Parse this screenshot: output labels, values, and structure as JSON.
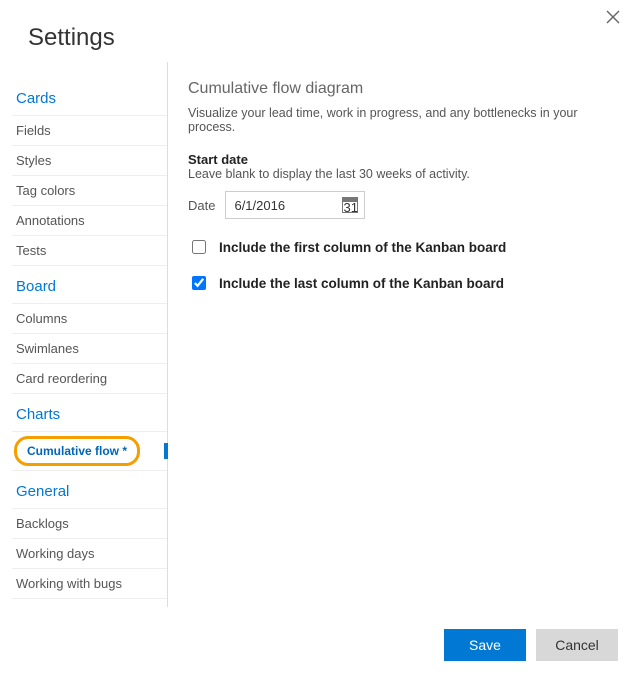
{
  "title": "Settings",
  "sidebar": {
    "sections": [
      {
        "head": "Cards",
        "items": [
          "Fields",
          "Styles",
          "Tag colors",
          "Annotations",
          "Tests"
        ]
      },
      {
        "head": "Board",
        "items": [
          "Columns",
          "Swimlanes",
          "Card reordering"
        ]
      },
      {
        "head": "Charts",
        "items": [
          "Cumulative flow *"
        ],
        "selectedIndex": 0
      },
      {
        "head": "General",
        "items": [
          "Backlogs",
          "Working days",
          "Working with bugs"
        ]
      }
    ]
  },
  "panel": {
    "title": "Cumulative flow diagram",
    "description": "Visualize your lead time, work in progress, and any bottlenecks in your process.",
    "startDate": {
      "label": "Start date",
      "help": "Leave blank to display the last 30 weeks of activity.",
      "caption": "Date",
      "value": "6/1/2016",
      "iconDay": "31"
    },
    "options": {
      "includeFirst": {
        "label": "Include the first column of the Kanban board",
        "checked": false
      },
      "includeLast": {
        "label": "Include the last column of the Kanban board",
        "checked": true
      }
    }
  },
  "footer": {
    "save": "Save",
    "cancel": "Cancel"
  }
}
